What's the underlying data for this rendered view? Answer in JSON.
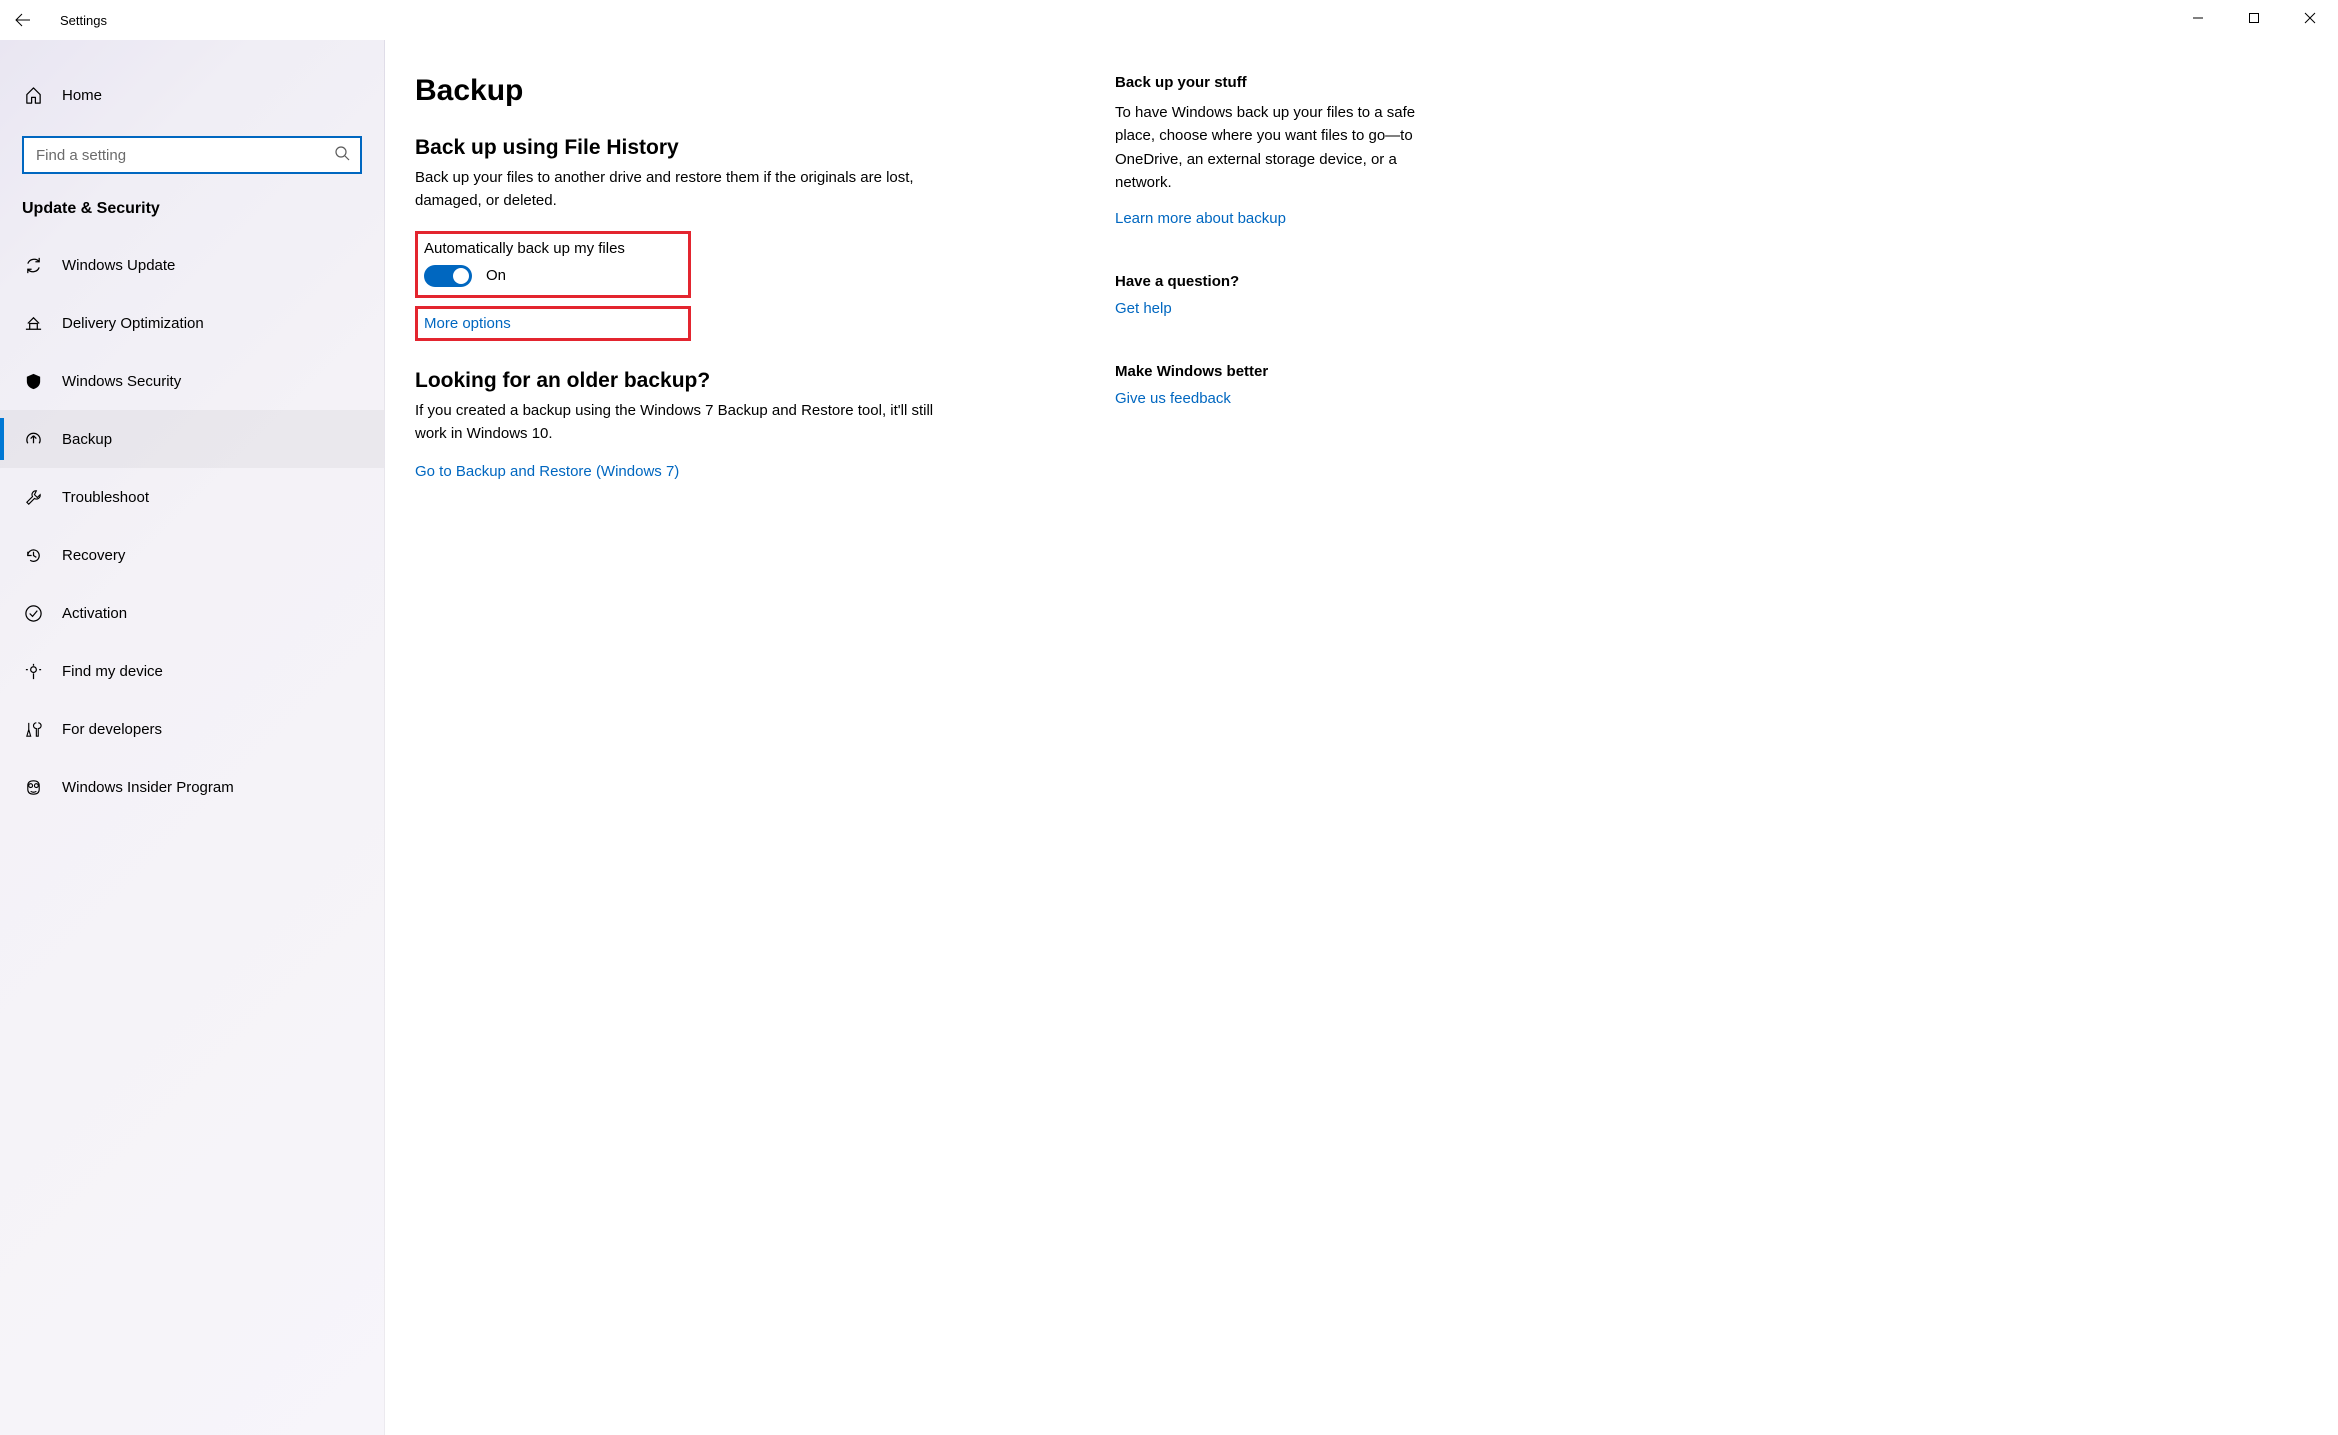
{
  "titlebar": {
    "title": "Settings"
  },
  "sidebar": {
    "home": "Home",
    "search_placeholder": "Find a setting",
    "section": "Update & Security",
    "items": [
      {
        "label": "Windows Update"
      },
      {
        "label": "Delivery Optimization"
      },
      {
        "label": "Windows Security"
      },
      {
        "label": "Backup"
      },
      {
        "label": "Troubleshoot"
      },
      {
        "label": "Recovery"
      },
      {
        "label": "Activation"
      },
      {
        "label": "Find my device"
      },
      {
        "label": "For developers"
      },
      {
        "label": "Windows Insider Program"
      }
    ]
  },
  "main": {
    "title": "Backup",
    "fh": {
      "heading": "Back up using File History",
      "desc": "Back up your files to another drive and restore them if the originals are lost, damaged, or deleted.",
      "toggle_label": "Automatically back up my files",
      "toggle_state": "On",
      "more_options": "More options"
    },
    "older": {
      "heading": "Looking for an older backup?",
      "desc": "If you created a backup using the Windows 7 Backup and Restore tool, it'll still work in Windows 10.",
      "link": "Go to Backup and Restore (Windows 7)"
    }
  },
  "aside": {
    "stuff": {
      "heading": "Back up your stuff",
      "desc": "To have Windows back up your files to a safe place, choose where you want files to go—to OneDrive, an external storage device, or a network.",
      "link": "Learn more about backup"
    },
    "question": {
      "heading": "Have a question?",
      "link": "Get help"
    },
    "feedback": {
      "heading": "Make Windows better",
      "link": "Give us feedback"
    }
  }
}
